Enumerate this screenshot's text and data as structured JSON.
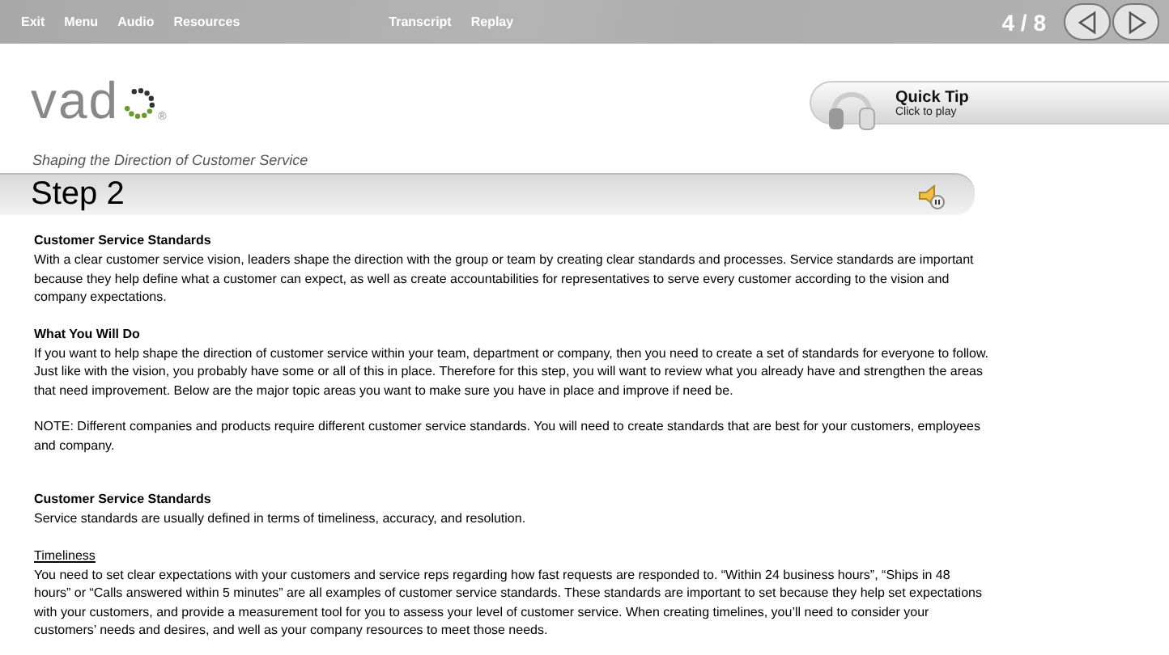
{
  "menu": [
    {
      "label": "Exit"
    },
    {
      "label": "Menu"
    },
    {
      "label": "Audio"
    },
    {
      "label": "Resources"
    }
  ],
  "menu_right": [
    {
      "label": "Transcript"
    },
    {
      "label": "Replay"
    }
  ],
  "page_counter": "4 / 8",
  "logo": {
    "text": "vad",
    "mark": "®"
  },
  "quick_tip": {
    "title": "Quick Tip",
    "subtitle": "Click to play"
  },
  "tagline": "Shaping the Direction of Customer Service",
  "step_title": "Step 2",
  "sections": [
    [
      {
        "kind": "heading",
        "text": "Customer Service Standards"
      },
      {
        "kind": "paragraph",
        "text": "With a clear customer service vision, leaders shape the direction with the group or team by creating clear standards and processes. Service standards are important because they help define what a customer can expect, as well as create accountabilities for representatives to serve every customer according to the vision and company expectations."
      }
    ],
    [
      {
        "kind": "heading",
        "text": "What You Will Do"
      },
      {
        "kind": "paragraph",
        "text": "If you want to help shape the direction of customer service within your team, department or company, then you need to create a set of standards for everyone to follow. Just like with the vision, you probably have some or all of this in place. Therefore for this step, you will want to review what you already have and strengthen the areas that need improvement. Below are the major topic areas you want to make sure you have in place and improve if need be."
      }
    ],
    [
      {
        "kind": "paragraph",
        "text": "NOTE: Different companies and products require different customer service standards. You will need to create standards that are best for your customers, employees and company."
      }
    ],
    [
      {
        "kind": "heading",
        "text": "Customer Service Standards"
      },
      {
        "kind": "paragraph",
        "text": "Service standards are usually defined in terms of timeliness, accuracy, and resolution."
      }
    ],
    [
      {
        "kind": "subheading",
        "text": "Timeliness"
      },
      {
        "kind": "paragraph",
        "text": "You need to set clear expectations with your customers and service reps regarding how fast requests are responded to. “Within 24 business hours”, “Ships in 48 hours” or “Calls answered within 5 minutes” are all examples of customer service standards. These standards are important to set because they help set expectations with your customers, and provide a measurement tool for you to assess your level of customer service. When creating timelines, you’ll need to consider your customers’ needs and desires, and well as your company resources to meet those needs."
      }
    ]
  ]
}
